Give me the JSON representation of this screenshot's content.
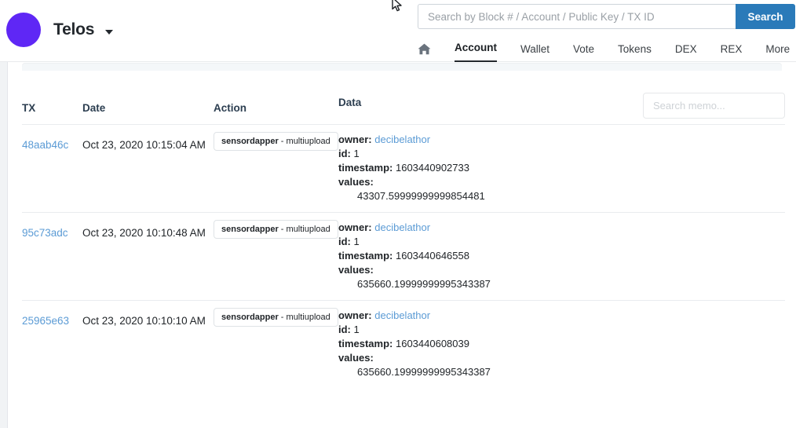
{
  "header": {
    "brand_name": "Telos",
    "brand_caret_icon": "chevron-down-icon",
    "logo_icon": "telos-logo-icon",
    "search": {
      "placeholder": "Search by Block # / Account / Public Key / TX ID",
      "value": "",
      "button_label": "Search"
    },
    "nav": {
      "home_icon": "home-icon",
      "items": [
        {
          "label": "Account",
          "active": true
        },
        {
          "label": "Wallet",
          "active": false
        },
        {
          "label": "Vote",
          "active": false
        },
        {
          "label": "Tokens",
          "active": false
        },
        {
          "label": "DEX",
          "active": false
        },
        {
          "label": "REX",
          "active": false
        }
      ],
      "more_label": "More",
      "more_caret_icon": "chevron-down-icon"
    }
  },
  "table": {
    "headers": {
      "tx": "TX",
      "date": "Date",
      "action": "Action",
      "data": "Data"
    },
    "memo_search": {
      "placeholder": "Search memo...",
      "value": ""
    },
    "rows": [
      {
        "tx": "48aab46c",
        "date": "Oct 23, 2020 10:15:04 AM",
        "action_contract": "sensordapper",
        "action_separator": " - ",
        "action_name": "multiupload",
        "data": {
          "owner_key": "owner:",
          "owner_value": "decibelathor",
          "id_key": "id:",
          "id_value": "1",
          "timestamp_key": "timestamp:",
          "timestamp_value": "1603440902733",
          "values_key": "values:",
          "values_value": "43307.59999999999854481"
        }
      },
      {
        "tx": "95c73adc",
        "date": "Oct 23, 2020 10:10:48 AM",
        "action_contract": "sensordapper",
        "action_separator": " - ",
        "action_name": "multiupload",
        "data": {
          "owner_key": "owner:",
          "owner_value": "decibelathor",
          "id_key": "id:",
          "id_value": "1",
          "timestamp_key": "timestamp:",
          "timestamp_value": "1603440646558",
          "values_key": "values:",
          "values_value": "635660.19999999995343387"
        }
      },
      {
        "tx": "25965e63",
        "date": "Oct 23, 2020 10:10:10 AM",
        "action_contract": "sensordapper",
        "action_separator": " - ",
        "action_name": "multiupload",
        "data": {
          "owner_key": "owner:",
          "owner_value": "decibelathor",
          "id_key": "id:",
          "id_value": "1",
          "timestamp_key": "timestamp:",
          "timestamp_value": "1603440608039",
          "values_key": "values:",
          "values_value": "635660.19999999995343387"
        }
      }
    ]
  },
  "colors": {
    "brand_purple": "#5f27f5",
    "link_blue": "#5b9bd5",
    "search_button_blue": "#2a7ab9",
    "page_background": "#f1f3f5"
  },
  "cursor": {
    "icon": "mouse-pointer-icon"
  }
}
